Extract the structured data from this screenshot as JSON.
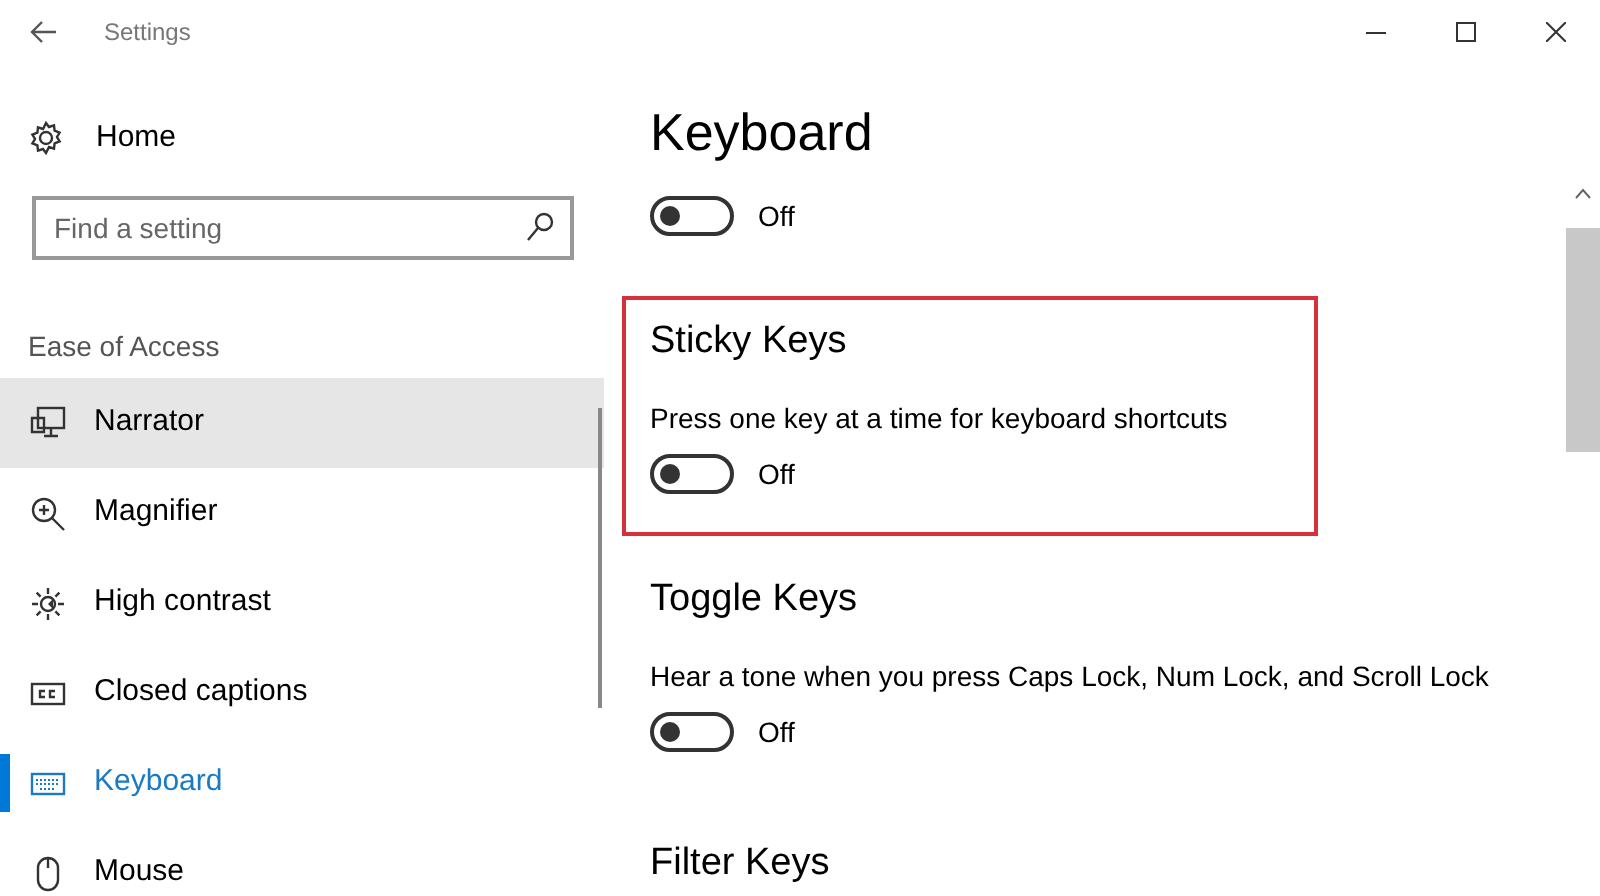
{
  "window": {
    "title": "Settings"
  },
  "sidebar": {
    "home": "Home",
    "search": {
      "placeholder": "Find a setting"
    },
    "group": "Ease of Access",
    "items": [
      {
        "label": "Narrator",
        "selected": false,
        "hovered": true
      },
      {
        "label": "Magnifier",
        "selected": false,
        "hovered": false
      },
      {
        "label": "High contrast",
        "selected": false,
        "hovered": false
      },
      {
        "label": "Closed captions",
        "selected": false,
        "hovered": false
      },
      {
        "label": "Keyboard",
        "selected": true,
        "hovered": false
      },
      {
        "label": "Mouse",
        "selected": false,
        "hovered": false
      }
    ]
  },
  "page_title": "Keyboard",
  "sections": [
    {
      "toggle": {
        "on": false,
        "label": "Off"
      }
    },
    {
      "heading": "Sticky Keys",
      "description": "Press one key at a time for keyboard shortcuts",
      "highlighted": true,
      "toggle": {
        "on": false,
        "label": "Off"
      }
    },
    {
      "heading": "Toggle Keys",
      "description": "Hear a tone when you press Caps Lock, Num Lock, and Scroll Lock",
      "toggle": {
        "on": false,
        "label": "Off"
      }
    },
    {
      "heading": "Filter Keys"
    }
  ]
}
